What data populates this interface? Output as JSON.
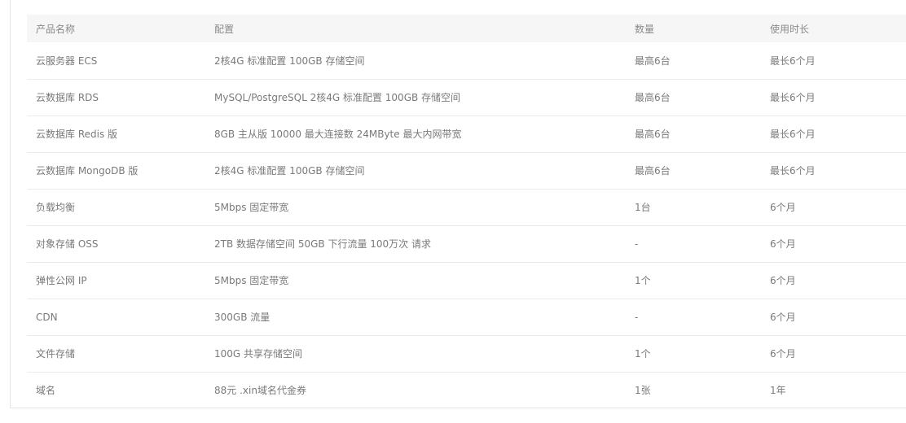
{
  "table": {
    "headers": [
      "产品名称",
      "配置",
      "数量",
      "使用时长"
    ],
    "rows": [
      {
        "name": "云服务器 ECS",
        "config": "2核4G 标准配置   100GB 存储空间",
        "qty": "最高6台",
        "duration": "最长6个月"
      },
      {
        "name": "云数据库 RDS",
        "config": "MySQL/PostgreSQL 2核4G 标准配置   100GB 存储空间",
        "qty": "最高6台",
        "duration": "最长6个月"
      },
      {
        "name": "云数据库 Redis 版",
        "config": "8GB 主从版  10000 最大连接数  24MByte 最大内网带宽",
        "qty": "最高6台",
        "duration": "最长6个月"
      },
      {
        "name": "云数据库 MongoDB 版",
        "config": "2核4G 标准配置   100GB 存储空间",
        "qty": "最高6台",
        "duration": "最长6个月"
      },
      {
        "name": "负载均衡",
        "config": "5Mbps 固定带宽",
        "qty": "1台",
        "duration": "6个月"
      },
      {
        "name": "对象存储 OSS",
        "config": "2TB 数据存储空间   50GB 下行流量   100万次 请求",
        "qty": "-",
        "duration": "6个月"
      },
      {
        "name": "弹性公网 IP",
        "config": "5Mbps 固定带宽",
        "qty": "1个",
        "duration": "6个月"
      },
      {
        "name": "CDN",
        "config": "300GB 流量",
        "qty": "-",
        "duration": "6个月"
      },
      {
        "name": "文件存储",
        "config": "100G 共享存储空间",
        "qty": "1个",
        "duration": "6个月"
      },
      {
        "name": "域名",
        "config": "88元 .xin域名代金券",
        "qty": "1张",
        "duration": "1年"
      }
    ]
  }
}
